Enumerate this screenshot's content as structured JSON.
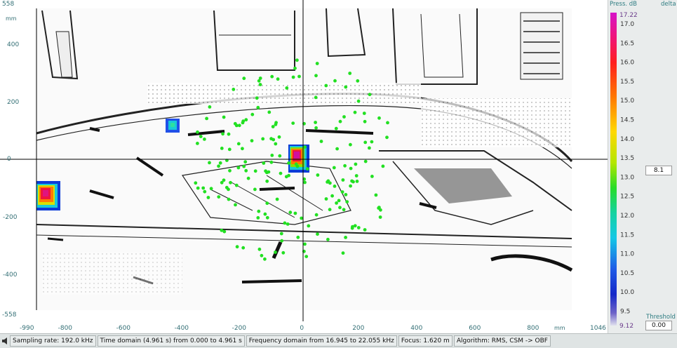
{
  "plot": {
    "y_max_label": "558",
    "y_min_label": "-558",
    "y_unit": "mm",
    "x_min_label": "-990",
    "x_max_label": "1046",
    "x_unit": "mm",
    "y_ticks": [
      "400",
      "200",
      "0",
      "-200",
      "-400"
    ],
    "x_ticks": [
      "-800",
      "-600",
      "-400",
      "-200",
      "0",
      "200",
      "400",
      "600",
      "800"
    ],
    "crosshair": {
      "x_mm": 0,
      "y_mm": 0
    },
    "hotspots": [
      {
        "name": "hotspot-left",
        "x_mm": -888,
        "y_mm": -120,
        "peak_db": 16.5
      },
      {
        "name": "hotspot-center",
        "x_mm": -15,
        "y_mm": 0,
        "peak_db": 17.2
      },
      {
        "name": "hotspot-upper",
        "x_mm": -450,
        "y_mm": 115,
        "peak_db": 11.5
      }
    ]
  },
  "color_scale": {
    "header_left": "Press. dB",
    "header_right": "delta",
    "max_value": "17.22",
    "min_value": "9.12",
    "ticks": [
      "17.0",
      "16.5",
      "16.0",
      "15.5",
      "15.0",
      "14.5",
      "14.0",
      "13.5",
      "13.0",
      "12.5",
      "12.0",
      "11.5",
      "11.0",
      "10.5",
      "10.0",
      "9.5"
    ],
    "range_value": "8.1",
    "threshold_label": "Threshold",
    "threshold_value": "0.00"
  },
  "status_bar": {
    "sampling_rate": "Sampling rate: 192.0 kHz",
    "time_domain": "Time domain (4.961 s) from 0.000 to 4.961 s",
    "frequency_domain": "Frequency domain from 16.945 to 22.055 kHz",
    "focus": "Focus: 1.620 m",
    "algorithm": "Algorithm: RMS, CSM -> OBF"
  },
  "icons": {
    "status_left": "speaker-icon"
  }
}
